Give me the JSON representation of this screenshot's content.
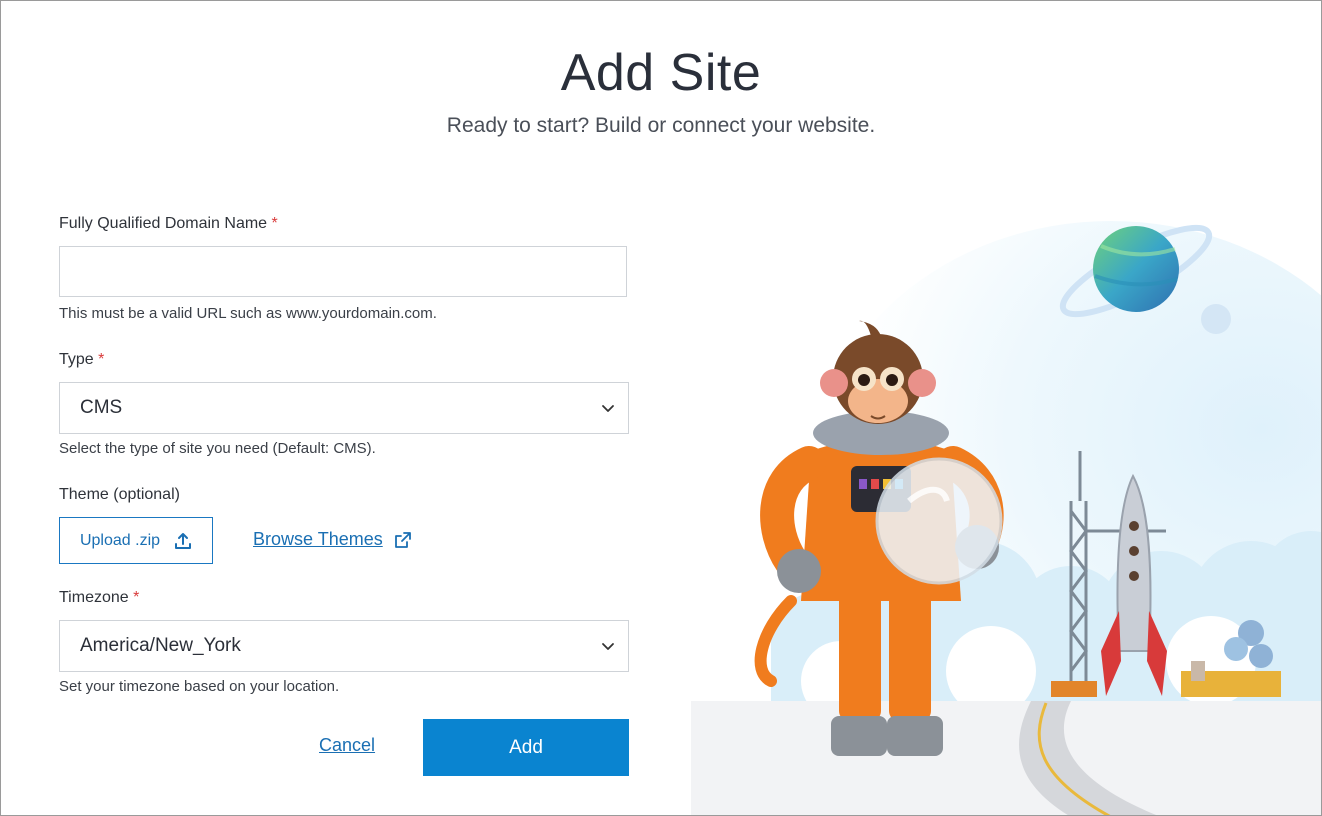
{
  "header": {
    "title": "Add Site",
    "subtitle": "Ready to start? Build or connect your website."
  },
  "form": {
    "domain": {
      "label": "Fully Qualified Domain Name",
      "required_mark": "*",
      "value": "",
      "help": "This must be a valid URL such as www.yourdomain.com."
    },
    "type": {
      "label": "Type",
      "required_mark": "*",
      "selected": "CMS",
      "help": "Select the type of site you need (Default: CMS)."
    },
    "theme": {
      "label": "Theme (optional)",
      "upload_label": "Upload .zip",
      "browse_label": "Browse Themes"
    },
    "timezone": {
      "label": "Timezone",
      "required_mark": "*",
      "selected": "America/New_York",
      "help": "Set your timezone based on your location."
    }
  },
  "actions": {
    "cancel_label": "Cancel",
    "add_label": "Add"
  },
  "icons": {
    "upload": "upload-icon",
    "external": "external-link-icon",
    "chevron": "chevron-down-icon"
  },
  "colors": {
    "accent": "#0a84d0",
    "link": "#1a6fb3",
    "required": "#d93a3a",
    "suit": "#f07c1e"
  }
}
